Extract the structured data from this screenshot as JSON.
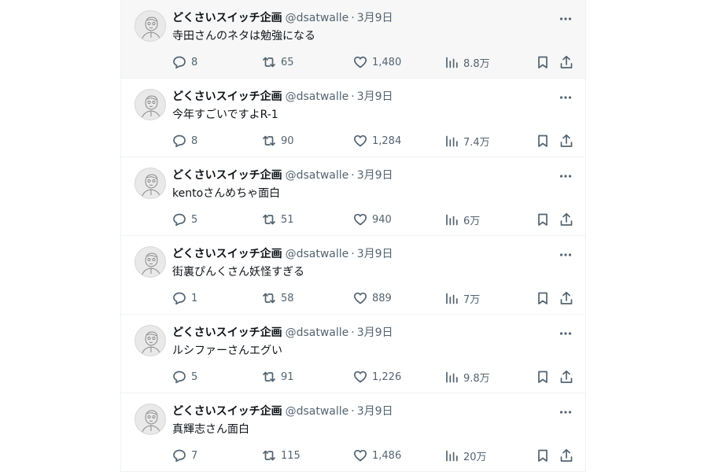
{
  "timeline": {
    "tweets": [
      {
        "name": "どくさいスイッチ企画",
        "handle": "@dsatwalle",
        "separator": "·",
        "date": "3月9日",
        "text": "寺田さんのネタは勉強になる",
        "replies": "8",
        "retweets": "65",
        "likes": "1,480",
        "views": "8.8万"
      },
      {
        "name": "どくさいスイッチ企画",
        "handle": "@dsatwalle",
        "separator": "·",
        "date": "3月9日",
        "text": "今年すごいですよR-1",
        "replies": "8",
        "retweets": "90",
        "likes": "1,284",
        "views": "7.4万"
      },
      {
        "name": "どくさいスイッチ企画",
        "handle": "@dsatwalle",
        "separator": "·",
        "date": "3月9日",
        "text": "kentoさんめちゃ面白",
        "replies": "5",
        "retweets": "51",
        "likes": "940",
        "views": "6万"
      },
      {
        "name": "どくさいスイッチ企画",
        "handle": "@dsatwalle",
        "separator": "·",
        "date": "3月9日",
        "text": "街裏ぴんくさん妖怪すぎる",
        "replies": "1",
        "retweets": "58",
        "likes": "889",
        "views": "7万"
      },
      {
        "name": "どくさいスイッチ企画",
        "handle": "@dsatwalle",
        "separator": "·",
        "date": "3月9日",
        "text": "ルシファーさんエグい",
        "replies": "5",
        "retweets": "91",
        "likes": "1,226",
        "views": "9.8万"
      },
      {
        "name": "どくさいスイッチ企画",
        "handle": "@dsatwalle",
        "separator": "·",
        "date": "3月9日",
        "text": "真輝志さん面白",
        "replies": "7",
        "retweets": "115",
        "likes": "1,486",
        "views": "20万"
      }
    ]
  },
  "colors": {
    "text_primary": "#0f1419",
    "text_secondary": "#536471",
    "divider": "#eff3f4",
    "hover_background": "#f7f7f7"
  },
  "icons": [
    "avatar-sketch",
    "more-icon",
    "reply-icon",
    "retweet-icon",
    "like-icon",
    "views-icon",
    "bookmark-icon",
    "share-icon"
  ]
}
